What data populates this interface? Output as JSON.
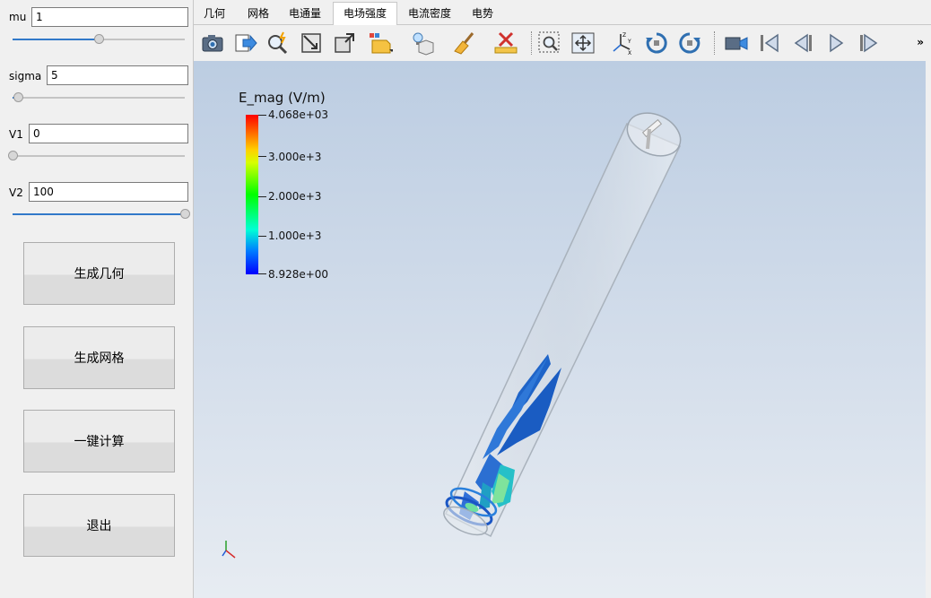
{
  "params": {
    "mu": {
      "label": "mu",
      "value": "1",
      "slider": 0.5
    },
    "sigma": {
      "label": "sigma",
      "value": "5",
      "slider": 0.03
    },
    "v1": {
      "label": "V1",
      "value": "0",
      "slider": 0.0
    },
    "v2": {
      "label": "V2",
      "value": "100",
      "slider": 1.0
    }
  },
  "buttons": {
    "gen_geometry": "生成几何",
    "gen_mesh": "生成网格",
    "compute": "一键计算",
    "exit": "退出"
  },
  "tabs": [
    "几何",
    "网格",
    "电通量",
    "电场强度",
    "电流密度",
    "电势"
  ],
  "active_tab": "电场强度",
  "toolbar_icons": [
    "camera-icon",
    "export-icon",
    "zoom-magic-icon",
    "reset-camera-icon",
    "maximize-icon",
    "selection-box-icon",
    "light-bulb-icon",
    "clean-brush-icon",
    "delete-ruler-icon",
    "zoom-box-icon",
    "fit-view-icon",
    "axes-icon",
    "rotate-cw-icon",
    "rotate-ccw-icon",
    "video-camera-icon",
    "first-frame-icon",
    "prev-frame-icon",
    "play-icon",
    "next-frame-icon",
    "more-icon"
  ],
  "legend": {
    "title": "E_mag (V/m)",
    "ticks": [
      "4.068e+03",
      "3.000e+3",
      "2.000e+3",
      "1.000e+3",
      "8.928e+00"
    ]
  },
  "colors": {
    "accent": "#3279c9",
    "viewport_top": "#bccde2",
    "viewport_bottom": "#e7ecf2"
  }
}
